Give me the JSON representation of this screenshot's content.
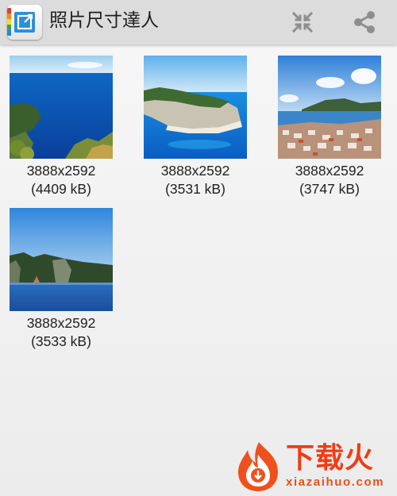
{
  "app": {
    "title": "照片尺寸達人"
  },
  "toolbar": {
    "actions": [
      "compress-action",
      "share-action"
    ]
  },
  "photos": [
    {
      "dimensions": "3888x2592",
      "size": "(4409 kB)"
    },
    {
      "dimensions": "3888x2592",
      "size": "(3531 kB)"
    },
    {
      "dimensions": "3888x2592",
      "size": "(3747 kB)"
    },
    {
      "dimensions": "3888x2592",
      "size": "(3533 kB)"
    }
  ],
  "watermark": {
    "name": "下载火",
    "url": "xiazaihuo.com"
  },
  "colors": {
    "appbar_bg": "#dcdcdc",
    "text": "#222222",
    "icon_gray": "#8e8e8e",
    "watermark_orange": "#f03c14"
  }
}
